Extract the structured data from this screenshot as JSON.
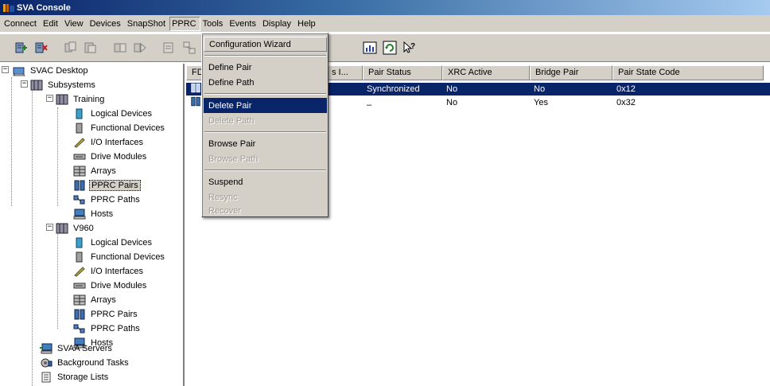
{
  "window": {
    "title": "SVA Console"
  },
  "menubar": [
    "Connect",
    "Edit",
    "View",
    "Devices",
    "SnapShot",
    "PPRC",
    "Tools",
    "Events",
    "Display",
    "Help"
  ],
  "pprc_menu": {
    "items": [
      {
        "label": "Configuration Wizard",
        "enabled": true
      },
      {
        "label": "Define Pair",
        "enabled": true
      },
      {
        "label": "Define Path",
        "enabled": true
      },
      {
        "label": "Delete Pair",
        "enabled": true,
        "highlighted": true
      },
      {
        "label": "Delete Path",
        "enabled": false
      },
      {
        "label": "Browse Pair",
        "enabled": true
      },
      {
        "label": "Browse Path",
        "enabled": false
      },
      {
        "label": "Suspend",
        "enabled": true
      },
      {
        "label": "Resync",
        "enabled": false
      },
      {
        "label": "Recover",
        "enabled": false
      }
    ]
  },
  "tree": {
    "desktop": "SVAC Desktop",
    "subsystems": "Subsystems",
    "training": {
      "name": "Training",
      "children": [
        "Logical Devices",
        "Functional Devices",
        "I/O Interfaces",
        "Drive Modules",
        "Arrays",
        "PPRC Pairs",
        "PPRC Paths",
        "Hosts"
      ],
      "selected": "PPRC Pairs"
    },
    "v960": {
      "name": "V960",
      "children": [
        "Logical Devices",
        "Functional Devices",
        "I/O Interfaces",
        "Drive Modules",
        "Arrays",
        "PPRC Pairs",
        "PPRC Paths",
        "Hosts"
      ]
    },
    "svaa_servers": "SVAA Servers",
    "background_tasks": "Background Tasks",
    "storage_lists": "Storage Lists"
  },
  "table": {
    "columns": [
      "FD",
      "s I...",
      "Pair Status",
      "XRC Active",
      "Bridge Pair",
      "Pair State Code"
    ],
    "rows": [
      {
        "status": "Synchronized",
        "xrc": "No",
        "bridge": "No",
        "code": "0x12",
        "selected": true
      },
      {
        "status": "–",
        "xrc": "No",
        "bridge": "Yes",
        "code": "0x32",
        "selected": false
      }
    ]
  },
  "colors": {
    "selection": "#0a246a",
    "chrome": "#d4d0c8",
    "title_gradient_start": "#0a246a"
  }
}
